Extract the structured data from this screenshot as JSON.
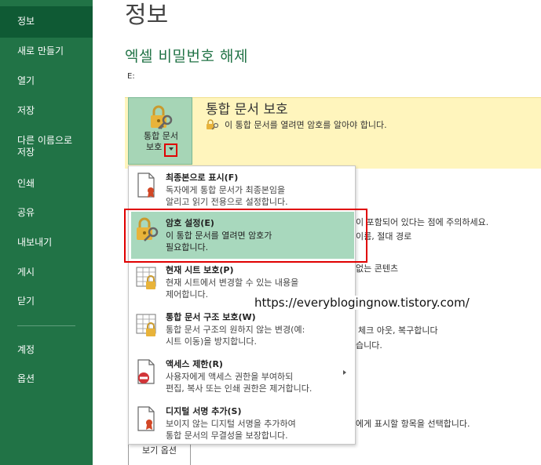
{
  "sidebar": {
    "items": [
      {
        "label": "정보"
      },
      {
        "label": "새로 만들기"
      },
      {
        "label": "열기"
      },
      {
        "label": "저장"
      },
      {
        "label": "다른 이름으로\n저장"
      },
      {
        "label": "인쇄"
      },
      {
        "label": "공유"
      },
      {
        "label": "내보내기"
      },
      {
        "label": "게시"
      },
      {
        "label": "닫기"
      },
      {
        "label": "계정"
      },
      {
        "label": "옵션"
      }
    ]
  },
  "header": {
    "page_title": "정보",
    "doc_title": "엑셀 비밀번호 해제",
    "doc_path": "E:"
  },
  "protect": {
    "button_label_line1": "통합 문서",
    "button_label_line2": "보호",
    "heading": "통합 문서 보호",
    "description": "이 통합 문서를 열려면 암호를 알아야 합니다."
  },
  "background_text": {
    "line1": "이 포함되어 있다는 점에 주의하세요.",
    "line2": "이름, 절대 경로",
    "line3": "없는 콘텐츠",
    "line4": "체크 아웃, 복구합니다",
    "line5": "습니다.",
    "line6": "에게 표시할 항목을 선택합니다.",
    "options_btn": "보기 옵션"
  },
  "menu": {
    "items": [
      {
        "title": "최종본으로 표시(F)",
        "desc": "독자에게 통합 문서가 최종본임을\n알리고 읽기 전용으로 설정합니다."
      },
      {
        "title": "암호 설정(E)",
        "desc": "이 통합 문서를 열려면 암호가\n필요합니다."
      },
      {
        "title": "현재 시트 보호(P)",
        "desc": "현재 시트에서 변경할 수 있는 내용을\n제어합니다."
      },
      {
        "title": "통합 문서 구조 보호(W)",
        "desc": "통합 문서 구조의 원하지 않는 변경(예:\n시트 이동)을 방지합니다."
      },
      {
        "title": "액세스 제한(R)",
        "desc": "사용자에게 액세스 권한을 부여하되\n편집, 복사 또는 인쇄 권한은 제거합니다."
      },
      {
        "title": "디지털 서명 추가(S)",
        "desc": "보이지 않는 디지털 서명을 추가하여\n통합 문서의 무결성을 보장합니다."
      }
    ]
  },
  "watermark": "https://everyblogingnow.tistory.com/",
  "colors": {
    "sidebar_bg": "#217346",
    "accent_green": "#217346",
    "highlight": "#a8d8bd",
    "protect_band": "#fff5bd",
    "annotation_red": "#e00000"
  }
}
